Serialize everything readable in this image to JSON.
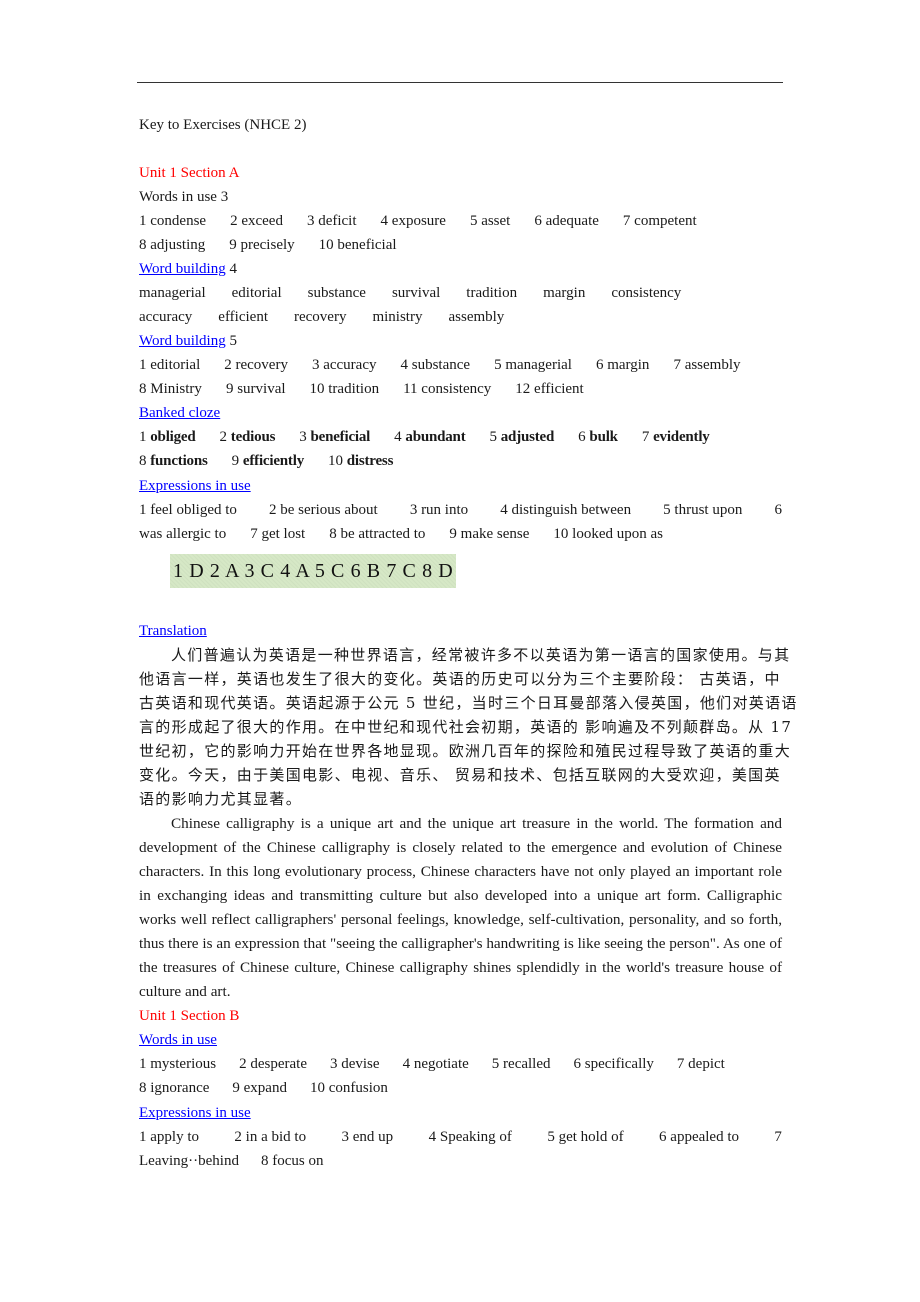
{
  "document": {
    "title": "Key to Exercises (NHCE 2)",
    "section_a": {
      "heading": "Unit 1 Section A",
      "words_in_use": {
        "label": "Words in use 3",
        "row1": [
          "1 condense",
          "2 exceed",
          "3 deficit",
          "4 exposure",
          "5 asset",
          "6 adequate",
          "7 competent"
        ],
        "row2": [
          "8 adjusting",
          "9 precisely",
          "10 beneficial"
        ]
      },
      "word_building_4": {
        "link": "Word building",
        "suffix": " 4",
        "row1": [
          "managerial",
          "editorial",
          "substance",
          "survival",
          "tradition",
          "margin",
          "consistency"
        ],
        "row2": [
          "accuracy",
          "efficient",
          "recovery",
          "ministry",
          "assembly"
        ]
      },
      "word_building_5": {
        "link": "Word building",
        "suffix": " 5",
        "row1": [
          "1 editorial",
          "2 recovery",
          "3 accuracy",
          "4 substance",
          "5 managerial",
          "6 margin",
          "7 assembly"
        ],
        "row2": [
          "8 Ministry",
          "9 survival",
          "10 tradition",
          "11 consistency",
          "12 efficient"
        ]
      },
      "banked_cloze": {
        "link": "Banked cloze",
        "row1": [
          {
            "num": "1",
            "word": "obliged"
          },
          {
            "num": "2",
            "word": "tedious"
          },
          {
            "num": "3",
            "word": "beneficial"
          },
          {
            "num": "4",
            "word": "abundant"
          },
          {
            "num": "5",
            "word": "adjusted"
          },
          {
            "num": "6",
            "word": "bulk"
          },
          {
            "num": "7",
            "word": "evidently"
          }
        ],
        "row2": [
          {
            "num": "8",
            "word": "functions"
          },
          {
            "num": "9",
            "word": "efficiently"
          },
          {
            "num": "10",
            "word": "distress"
          }
        ]
      },
      "expressions_in_use": {
        "link": "Expressions in use",
        "row1": [
          "1 feel obliged to",
          "2 be serious about",
          "3 run into",
          "4 distinguish between",
          "5 thrust upon",
          "6"
        ],
        "row2": [
          "was allergic to",
          "7 get lost",
          "8 be attracted to",
          "9 make sense",
          "10 looked upon as"
        ]
      },
      "answer_key": "1 D 2 A 3 C 4 A 5 C 6 B 7 C 8 D",
      "translation": {
        "link": "Translation",
        "chinese_lines": [
          "人们普遍认为英语是一种世界语言，经常被许多不以英语为第一语言的国家使用。与其",
          "他语言一样，英语也发生了很大的变化。英语的历史可以分为三个主要阶段：  古英语，中",
          "古英语和现代英语。英语起源于公元 5 世纪，当时三个日耳曼部落入侵英国，他们对英语语",
          "言的形成起了很大的作用。在中世纪和现代社会初期，英语的 影响遍及不列颠群岛。从 17",
          "世纪初，它的影响力开始在世界各地显现。欧洲几百年的探险和殖民过程导致了英语的重大",
          "变化。今天，由于美国电影、电视、音乐、 贸易和技术、包括互联网的大受欢迎，美国英",
          "语的影响力尤其显著。"
        ],
        "english_paragraph": "Chinese calligraphy is a unique art and the unique art treasure in the world. The formation and development of the Chinese calligraphy is closely related to the emergence and evolution of Chinese characters. In this long evolutionary process, Chinese characters have not only played an important role in exchanging ideas and transmitting culture but also developed into a unique art form. Calligraphic works well reflect calligraphers' personal feelings, knowledge, self-cultivation, personality, and so forth, thus there is an expression that \"seeing the calligrapher's handwriting is like seeing the person\". As one of the treasures of Chinese culture, Chinese calligraphy shines splendidly in the world's treasure house of culture and art."
      }
    },
    "section_b": {
      "heading": "Unit 1 Section B",
      "words_in_use": {
        "link": "Words in use",
        "row1": [
          "1 mysterious",
          "2 desperate",
          "3 devise",
          "4 negotiate",
          "5 recalled",
          "6 specifically",
          "7 depict"
        ],
        "row2": [
          "8 ignorance",
          "9 expand",
          "10 confusion"
        ]
      },
      "expressions_in_use": {
        "link": "Expressions in use",
        "row1": [
          "1 apply to",
          "2 in a bid to",
          "3 end up",
          "4 Speaking of",
          "5 get hold of",
          "6 appealed to",
          "7"
        ],
        "row2": [
          "Leaving··behind",
          "8 focus on"
        ]
      }
    }
  },
  "colors": {
    "heading_red": "#ff0000",
    "link_blue": "#0000ff",
    "answer_highlight": "#d6e8c6",
    "text": "#1a1a1a"
  }
}
